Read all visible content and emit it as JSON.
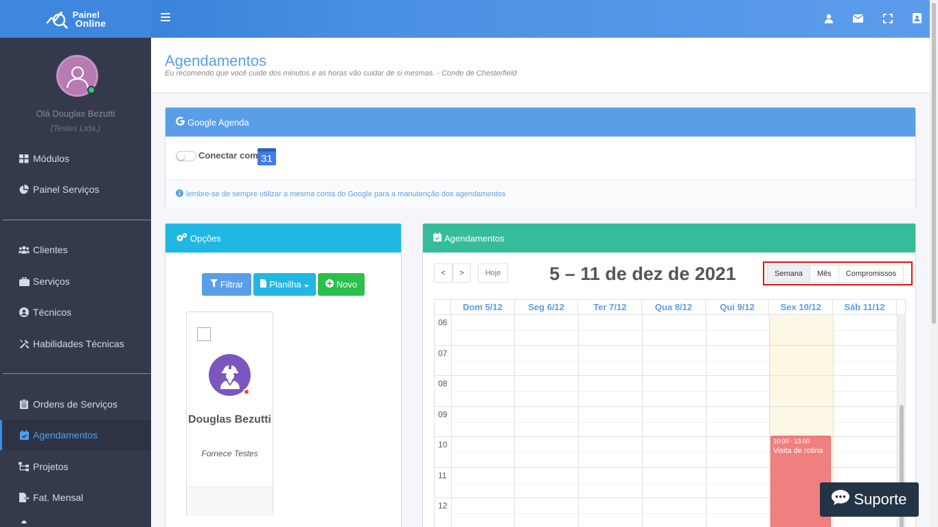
{
  "brand": {
    "line1": "Painel",
    "line2": "Online"
  },
  "topbar": {
    "icons": [
      "user-icon",
      "envelope-icon",
      "fullscreen-icon",
      "address-book-icon"
    ]
  },
  "user": {
    "greeting": "Olá Douglas Bezutti",
    "company": "(Testes Ltda.)"
  },
  "sidebar": {
    "items": [
      {
        "label": "Módulos",
        "icon": "grid-icon"
      },
      {
        "label": "Painel Serviços",
        "icon": "pie-chart-icon"
      },
      {
        "label": "Clientes",
        "icon": "users-icon"
      },
      {
        "label": "Serviços",
        "icon": "briefcase-icon"
      },
      {
        "label": "Técnicos",
        "icon": "user-circle-icon"
      },
      {
        "label": "Habilidades Técnicas",
        "icon": "tools-icon"
      },
      {
        "label": "Ordens de Serviços",
        "icon": "clipboard-icon"
      },
      {
        "label": "Agendamentos",
        "icon": "calendar-check-icon",
        "active": true
      },
      {
        "label": "Projetos",
        "icon": "sitemap-icon"
      },
      {
        "label": "Fat. Mensal",
        "icon": "file-export-icon"
      }
    ]
  },
  "header": {
    "title": "Agendamentos",
    "subtitle": "Eu recomendo que você cuide dos minutos e as horas vão cuidar de si mesmas. - Conde de Chesterfield"
  },
  "google": {
    "title": "Google Agenda",
    "connect_label": "Conectar com",
    "calendar_badge": "31",
    "note": "lembre-se de sempre utilizar a mesma conta do Google para a manutenção dos agendamentos"
  },
  "options": {
    "title": "Opções",
    "filter_label": "Filtrar",
    "sheet_label": "Planilha",
    "new_label": "Novo",
    "technician": {
      "name": "Douglas Bezutti",
      "company": "Fornece Testes"
    }
  },
  "schedule": {
    "title": "Agendamentos",
    "prev": "<",
    "next": ">",
    "today": "Hoje",
    "range_title": "5 – 11 de dez de 2021",
    "views": [
      "Semana",
      "Mês",
      "Compromissos"
    ],
    "days": [
      "Dom 5/12",
      "Seg 6/12",
      "Ter 7/12",
      "Qua 8/12",
      "Qui 9/12",
      "Sex 10/12",
      "Sáb 11/12"
    ],
    "hours": [
      "06",
      "07",
      "08",
      "09",
      "10",
      "11",
      "12"
    ],
    "event": {
      "time": "10:00 - 13:00",
      "title": "Visita de rotina"
    }
  },
  "support": {
    "label": "Suporte"
  },
  "colors": {
    "topbar": "#4a90e2",
    "sidebar": "#343a4c",
    "accent": "#5b9ee8",
    "options_header": "#21b7e3",
    "schedule_header": "#37bc9b",
    "event": "#f08080",
    "highlight_box": "#e41010"
  }
}
